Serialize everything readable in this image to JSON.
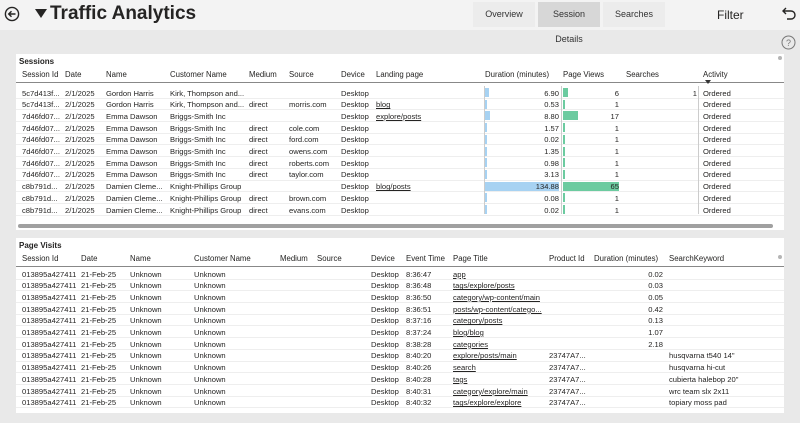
{
  "app": {
    "title": "Traffic Analytics"
  },
  "nav": {
    "tabs": [
      "Overview",
      "Session Details",
      "Searches"
    ],
    "filter_label": "Filter"
  },
  "colors": {
    "duration_bar": "#a7d2f2",
    "pageviews_bar": "#6ccba0"
  },
  "sessions": {
    "title": "Sessions",
    "columns": [
      "Session Id",
      "Date",
      "Name",
      "Customer Name",
      "Medium",
      "Source",
      "Device",
      "Landing page",
      "Duration (minutes)",
      "Page Views",
      "Searches",
      "Activity"
    ],
    "rows": [
      [
        "5c7d413f...",
        "2/1/2025",
        "Gordon Harris",
        "Kirk, Thompson and...",
        "",
        "",
        "Desktop",
        "",
        "6.90",
        "6",
        "1",
        "Ordered"
      ],
      [
        "5c7d413f...",
        "2/1/2025",
        "Gordon Harris",
        "Kirk, Thompson and...",
        "direct",
        "morris.com",
        "Desktop",
        "blog",
        "0.53",
        "1",
        "",
        "Ordered"
      ],
      [
        "7d46fd07...",
        "2/1/2025",
        "Emma Dawson",
        "Briggs-Smith Inc",
        "",
        "",
        "Desktop",
        "explore/posts",
        "8.80",
        "17",
        "",
        "Ordered"
      ],
      [
        "7d46fd07...",
        "2/1/2025",
        "Emma Dawson",
        "Briggs-Smith Inc",
        "direct",
        "cole.com",
        "Desktop",
        "",
        "1.57",
        "1",
        "",
        "Ordered"
      ],
      [
        "7d46fd07...",
        "2/1/2025",
        "Emma Dawson",
        "Briggs-Smith Inc",
        "direct",
        "ford.com",
        "Desktop",
        "",
        "0.02",
        "1",
        "",
        "Ordered"
      ],
      [
        "7d46fd07...",
        "2/1/2025",
        "Emma Dawson",
        "Briggs-Smith Inc",
        "direct",
        "owens.com",
        "Desktop",
        "",
        "1.35",
        "1",
        "",
        "Ordered"
      ],
      [
        "7d46fd07...",
        "2/1/2025",
        "Emma Dawson",
        "Briggs-Smith Inc",
        "direct",
        "roberts.com",
        "Desktop",
        "",
        "0.98",
        "1",
        "",
        "Ordered"
      ],
      [
        "7d46fd07...",
        "2/1/2025",
        "Emma Dawson",
        "Briggs-Smith Inc",
        "direct",
        "taylor.com",
        "Desktop",
        "",
        "3.13",
        "1",
        "",
        "Ordered"
      ],
      [
        "c8b791d...",
        "2/1/2025",
        "Damien Cleme...",
        "Knight-Phillips Group",
        "",
        "",
        "Desktop",
        "blog/posts",
        "134.88",
        "65",
        "",
        "Ordered"
      ],
      [
        "c8b791d...",
        "2/1/2025",
        "Damien Cleme...",
        "Knight-Phillips Group",
        "direct",
        "brown.com",
        "Desktop",
        "",
        "0.08",
        "1",
        "",
        "Ordered"
      ],
      [
        "c8b791d...",
        "2/1/2025",
        "Damien Cleme...",
        "Knight-Phillips Group",
        "direct",
        "evans.com",
        "Desktop",
        "",
        "0.02",
        "1",
        "",
        "Ordered"
      ]
    ]
  },
  "visits": {
    "title": "Page Visits",
    "columns": [
      "Session Id",
      "Date",
      "Name",
      "Customer Name",
      "Medium",
      "Source",
      "Device",
      "Event Time",
      "Page Title",
      "Product Id",
      "Duration (minutes)",
      "SearchKeyword"
    ],
    "rows": [
      [
        "013895a427411",
        "21-Feb-25",
        "Unknown",
        "Unknown",
        "",
        "",
        "Desktop",
        "8:36:47",
        "app",
        "",
        "0.02",
        ""
      ],
      [
        "013895a427411",
        "21-Feb-25",
        "Unknown",
        "Unknown",
        "",
        "",
        "Desktop",
        "8:36:48",
        "tags/explore/posts",
        "",
        "0.03",
        ""
      ],
      [
        "013895a427411",
        "21-Feb-25",
        "Unknown",
        "Unknown",
        "",
        "",
        "Desktop",
        "8:36:50",
        "category/wp-content/main",
        "",
        "0.05",
        ""
      ],
      [
        "013895a427411",
        "21-Feb-25",
        "Unknown",
        "Unknown",
        "",
        "",
        "Desktop",
        "8:36:51",
        "posts/wp-content/catego...",
        "",
        "0.42",
        ""
      ],
      [
        "013895a427411",
        "21-Feb-25",
        "Unknown",
        "Unknown",
        "",
        "",
        "Desktop",
        "8:37:16",
        "category/posts",
        "",
        "0.13",
        ""
      ],
      [
        "013895a427411",
        "21-Feb-25",
        "Unknown",
        "Unknown",
        "",
        "",
        "Desktop",
        "8:37:24",
        "blog/blog",
        "",
        "1.07",
        ""
      ],
      [
        "013895a427411",
        "21-Feb-25",
        "Unknown",
        "Unknown",
        "",
        "",
        "Desktop",
        "8:38:28",
        "categories",
        "",
        "2.18",
        ""
      ],
      [
        "013895a427411",
        "21-Feb-25",
        "Unknown",
        "Unknown",
        "",
        "",
        "Desktop",
        "8:40:20",
        "explore/posts/main",
        "23747A7...",
        "",
        "husqvarna t540 14\""
      ],
      [
        "013895a427411",
        "21-Feb-25",
        "Unknown",
        "Unknown",
        "",
        "",
        "Desktop",
        "8:40:26",
        "search",
        "23747A7...",
        "",
        "husqvarna hi-cut"
      ],
      [
        "013895a427411",
        "21-Feb-25",
        "Unknown",
        "Unknown",
        "",
        "",
        "Desktop",
        "8:40:28",
        "tags",
        "23747A7...",
        "",
        "cubierta halebop 20\""
      ],
      [
        "013895a427411",
        "21-Feb-25",
        "Unknown",
        "Unknown",
        "",
        "",
        "Desktop",
        "8:40:31",
        "category/explore/main",
        "23747A7...",
        "",
        "wrc team slx 2x11"
      ],
      [
        "013895a427411",
        "21-Feb-25",
        "Unknown",
        "Unknown",
        "",
        "",
        "Desktop",
        "8:40:32",
        "tags/explore/explore",
        "23747A7...",
        "",
        "topiary moss pad"
      ]
    ]
  }
}
